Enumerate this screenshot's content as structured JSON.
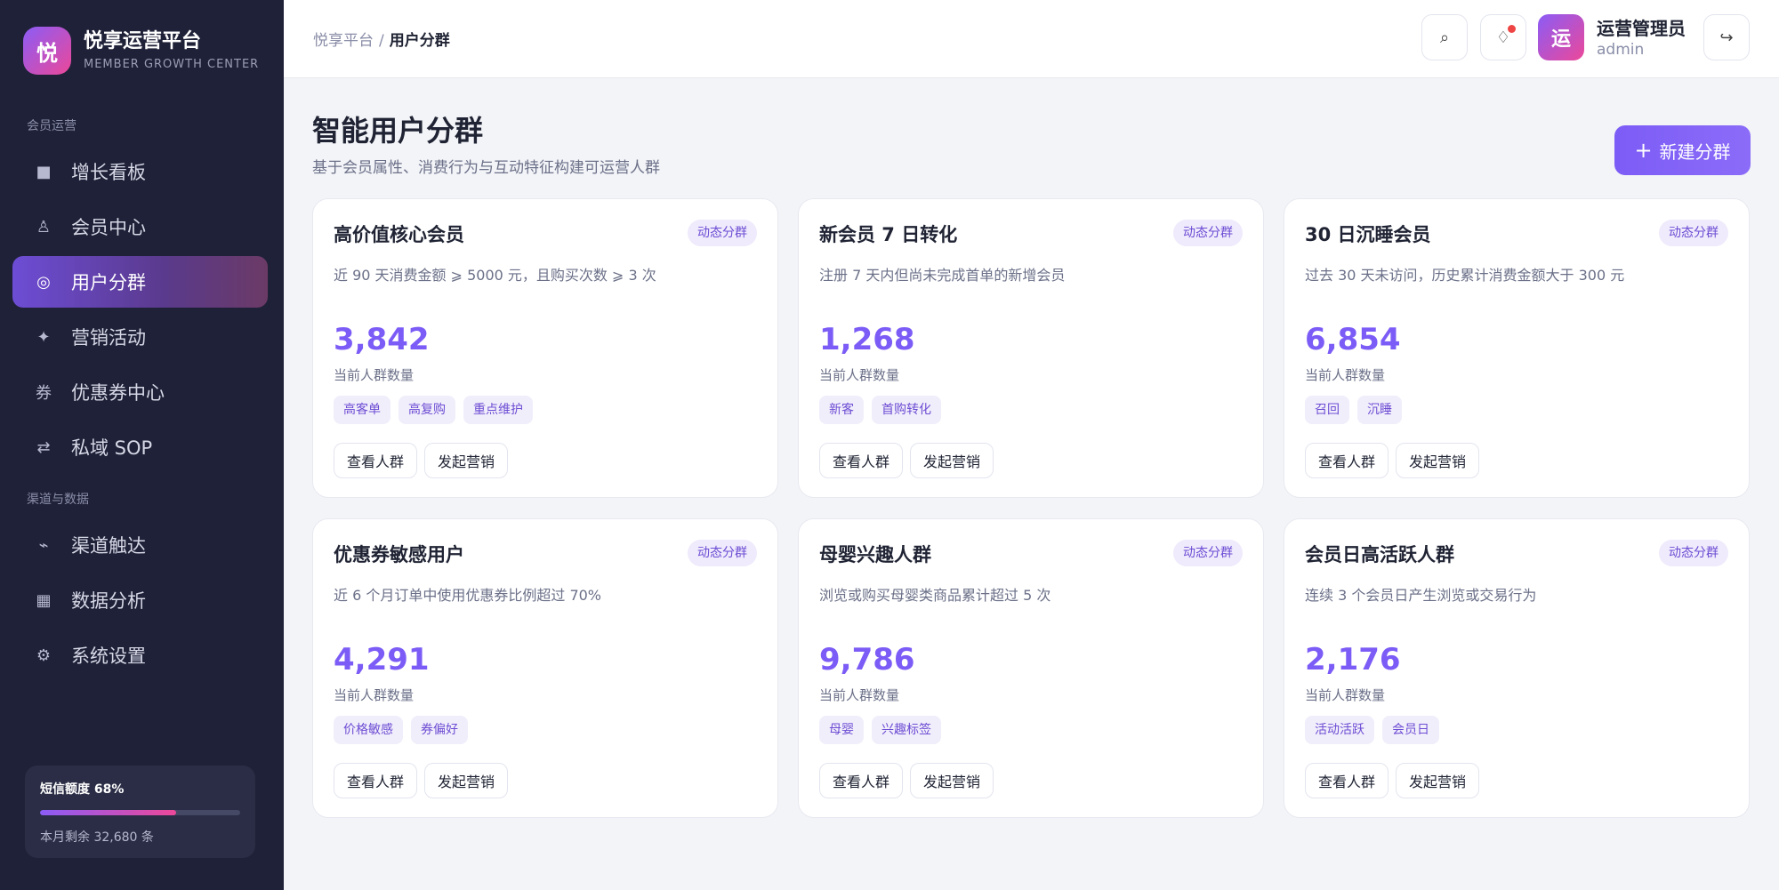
{
  "brand": {
    "logo_char": "悦",
    "name": "悦享运营平台",
    "subtitle": "MEMBER GROWTH CENTER"
  },
  "sidebar": {
    "group1": "会员运营",
    "group2": "渠道与数据",
    "items": [
      {
        "label": "增长看板",
        "icon": "dashboard-icon",
        "glyph": "■"
      },
      {
        "label": "会员中心",
        "icon": "member-icon",
        "glyph": "♙"
      },
      {
        "label": "用户分群",
        "icon": "segment-icon",
        "glyph": "◎"
      },
      {
        "label": "营销活动",
        "icon": "sparkle-icon",
        "glyph": "✦"
      },
      {
        "label": "优惠券中心",
        "icon": "coupon-icon",
        "glyph": "券"
      },
      {
        "label": "私域 SOP",
        "icon": "swap-icon",
        "glyph": "⇄"
      },
      {
        "label": "渠道触达",
        "icon": "signal-icon",
        "glyph": "⌁"
      },
      {
        "label": "数据分析",
        "icon": "chart-icon",
        "glyph": "▦"
      },
      {
        "label": "系统设置",
        "icon": "gear-icon",
        "glyph": "⚙"
      }
    ],
    "active_index": 2,
    "quota": {
      "title": "短信额度 68%",
      "percent": 68,
      "remaining": "本月剩余 32,680 条"
    }
  },
  "header": {
    "breadcrumb_root": "悦享平台",
    "breadcrumb_sep": "/",
    "breadcrumb_current": "用户分群",
    "search_glyph": "⌕",
    "notice_glyph": "♢",
    "avatar_char": "运",
    "user_name": "运营管理员",
    "user_id": "admin",
    "logout_glyph": "↪"
  },
  "main": {
    "title": "智能用户分群",
    "subtitle": "基于会员属性、消费行为与互动特征构建可运营人群",
    "new_button_plus": "+",
    "new_button": "新建分群",
    "count_label": "当前人群数量",
    "view_button": "查看人群",
    "campaign_button": "发起营销",
    "segments": [
      {
        "title": "高价值核心会员",
        "badge": "动态分群",
        "desc": "近 90 天消费金额 ⩾ 5000 元，且购买次数 ⩾ 3 次",
        "count": "3,842",
        "tags": [
          "高客单",
          "高复购",
          "重点维护"
        ]
      },
      {
        "title": "新会员 7 日转化",
        "badge": "动态分群",
        "desc": "注册 7 天内但尚未完成首单的新增会员",
        "count": "1,268",
        "tags": [
          "新客",
          "首购转化"
        ]
      },
      {
        "title": "30 日沉睡会员",
        "badge": "动态分群",
        "desc": "过去 30 天未访问，历史累计消费金额大于 300 元",
        "count": "6,854",
        "tags": [
          "召回",
          "沉睡"
        ]
      },
      {
        "title": "优惠券敏感用户",
        "badge": "动态分群",
        "desc": "近 6 个月订单中使用优惠券比例超过 70%",
        "count": "4,291",
        "tags": [
          "价格敏感",
          "券偏好"
        ]
      },
      {
        "title": "母婴兴趣人群",
        "badge": "动态分群",
        "desc": "浏览或购买母婴类商品累计超过 5 次",
        "count": "9,786",
        "tags": [
          "母婴",
          "兴趣标签"
        ]
      },
      {
        "title": "会员日高活跃人群",
        "badge": "动态分群",
        "desc": "连续 3 个会员日产生浏览或交易行为",
        "count": "2,176",
        "tags": [
          "活动活跃",
          "会员日"
        ]
      }
    ]
  }
}
